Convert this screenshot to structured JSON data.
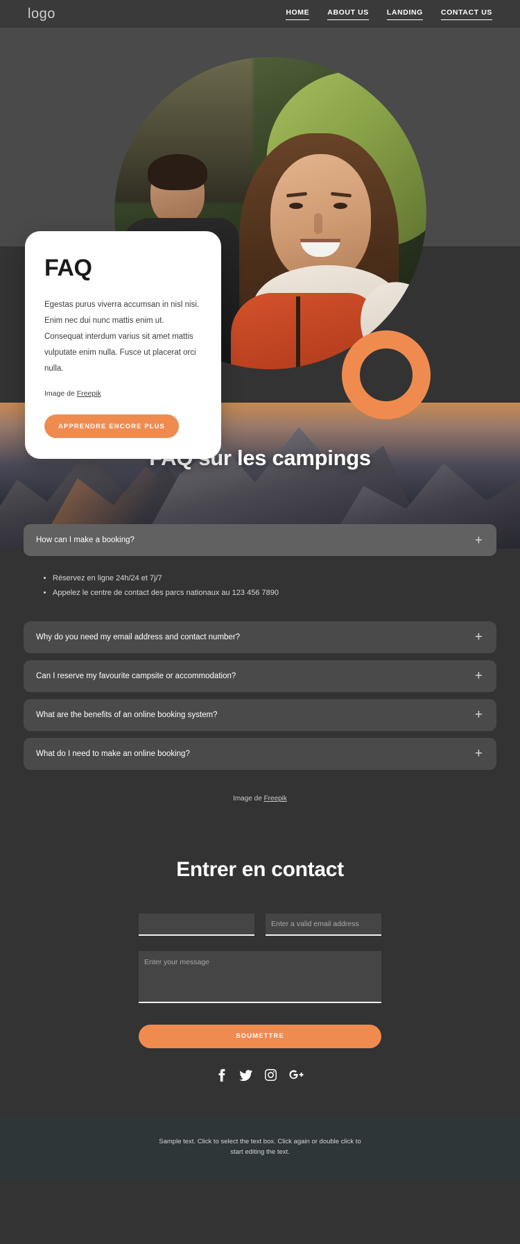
{
  "header": {
    "logo": "logo",
    "nav": [
      {
        "label": "HOME"
      },
      {
        "label": "ABOUT US"
      },
      {
        "label": "LANDING"
      },
      {
        "label": "CONTACT US"
      }
    ]
  },
  "hero": {
    "card": {
      "title": "FAQ",
      "body": "Egestas purus viverra accumsan in nisl nisi. Enim nec dui nunc mattis enim ut. Consequat interdum varius sit amet mattis vulputate enim nulla. Fusce ut placerat orci nulla.",
      "credit_prefix": "Image de ",
      "credit_link": "Freepik",
      "button": "APPRENDRE ENCORE PLUS"
    },
    "accent_color": "#f08b4f"
  },
  "faq": {
    "banner_title": "FAQ sur les campings",
    "open_item": {
      "question": "How can I make a booking?",
      "toggle_icon": "plus-icon",
      "answers": [
        "Réservez en ligne 24h/24 et 7j/7",
        "Appelez le centre de contact des parcs nationaux au 123 456 7890"
      ]
    },
    "items": [
      {
        "question": "Why do you need my email address and contact number?",
        "toggle_icon": "plus-icon"
      },
      {
        "question": "Can I reserve my favourite campsite or accommodation?",
        "toggle_icon": "plus-icon"
      },
      {
        "question": "What are the benefits of an online booking system?",
        "toggle_icon": "plus-icon"
      },
      {
        "question": "What do I need to make an online booking?",
        "toggle_icon": "plus-icon"
      }
    ],
    "credit_prefix": "Image de ",
    "credit_link": "Freepik"
  },
  "contact": {
    "title": "Entrer en contact",
    "name_value": "",
    "name_placeholder": "",
    "email_placeholder": "Enter a valid email address",
    "message_placeholder": "Enter your message",
    "submit_label": "SOUMETTRE",
    "socials": [
      {
        "name": "facebook-icon"
      },
      {
        "name": "twitter-icon"
      },
      {
        "name": "instagram-icon"
      },
      {
        "name": "google-plus-icon"
      }
    ]
  },
  "footer": {
    "text": "Sample text. Click to select the text box. Click again or double click to start editing the text."
  }
}
